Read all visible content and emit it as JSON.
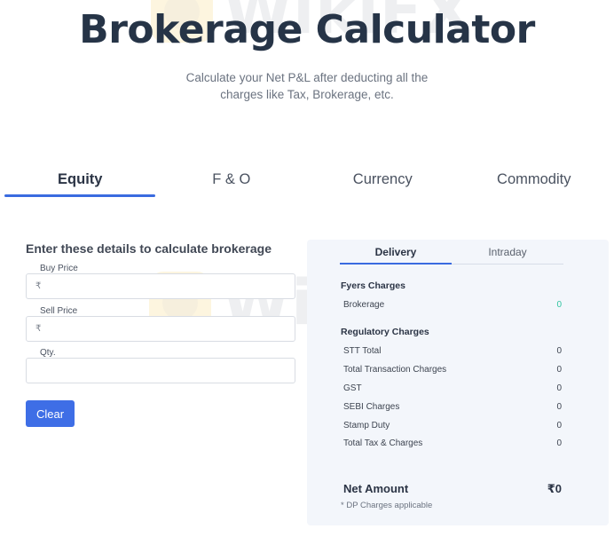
{
  "watermark": {
    "text": "WikiFX"
  },
  "header": {
    "title": "Brokerage Calculator",
    "subtitle": "Calculate your Net P&L after deducting all the charges like Tax, Brokerage, etc."
  },
  "tabs": [
    {
      "label": "Equity",
      "active": true
    },
    {
      "label": "F & O",
      "active": false
    },
    {
      "label": "Currency",
      "active": false
    },
    {
      "label": "Commodity",
      "active": false
    }
  ],
  "form": {
    "heading": "Enter these details to calculate brokerage",
    "buy_price": {
      "label": "Buy Price",
      "prefix": "₹",
      "value": ""
    },
    "sell_price": {
      "label": "Sell Price",
      "prefix": "₹",
      "value": ""
    },
    "qty": {
      "label": "Qty.",
      "value": ""
    },
    "clear_label": "Clear"
  },
  "results": {
    "tabs": [
      {
        "label": "Delivery",
        "active": true
      },
      {
        "label": "Intraday",
        "active": false
      }
    ],
    "fyers_title": "Fyers Charges",
    "brokerage": {
      "label": "Brokerage",
      "value": "0"
    },
    "regulatory_title": "Regulatory Charges",
    "regulatory": [
      {
        "label": "STT Total",
        "value": "0"
      },
      {
        "label": "Total Transaction Charges",
        "value": "0"
      },
      {
        "label": "GST",
        "value": "0"
      },
      {
        "label": "SEBI Charges",
        "value": "0"
      },
      {
        "label": "Stamp Duty",
        "value": "0"
      },
      {
        "label": "Total Tax & Charges",
        "value": "0"
      }
    ],
    "net_amount": {
      "label": "Net Amount",
      "value": "₹0"
    },
    "note": "* DP Charges applicable"
  },
  "colors": {
    "accent": "#3e6ee6",
    "title": "#263447",
    "brokerage_value": "#2ec4a0",
    "panel_bg": "#f3f6fb"
  }
}
